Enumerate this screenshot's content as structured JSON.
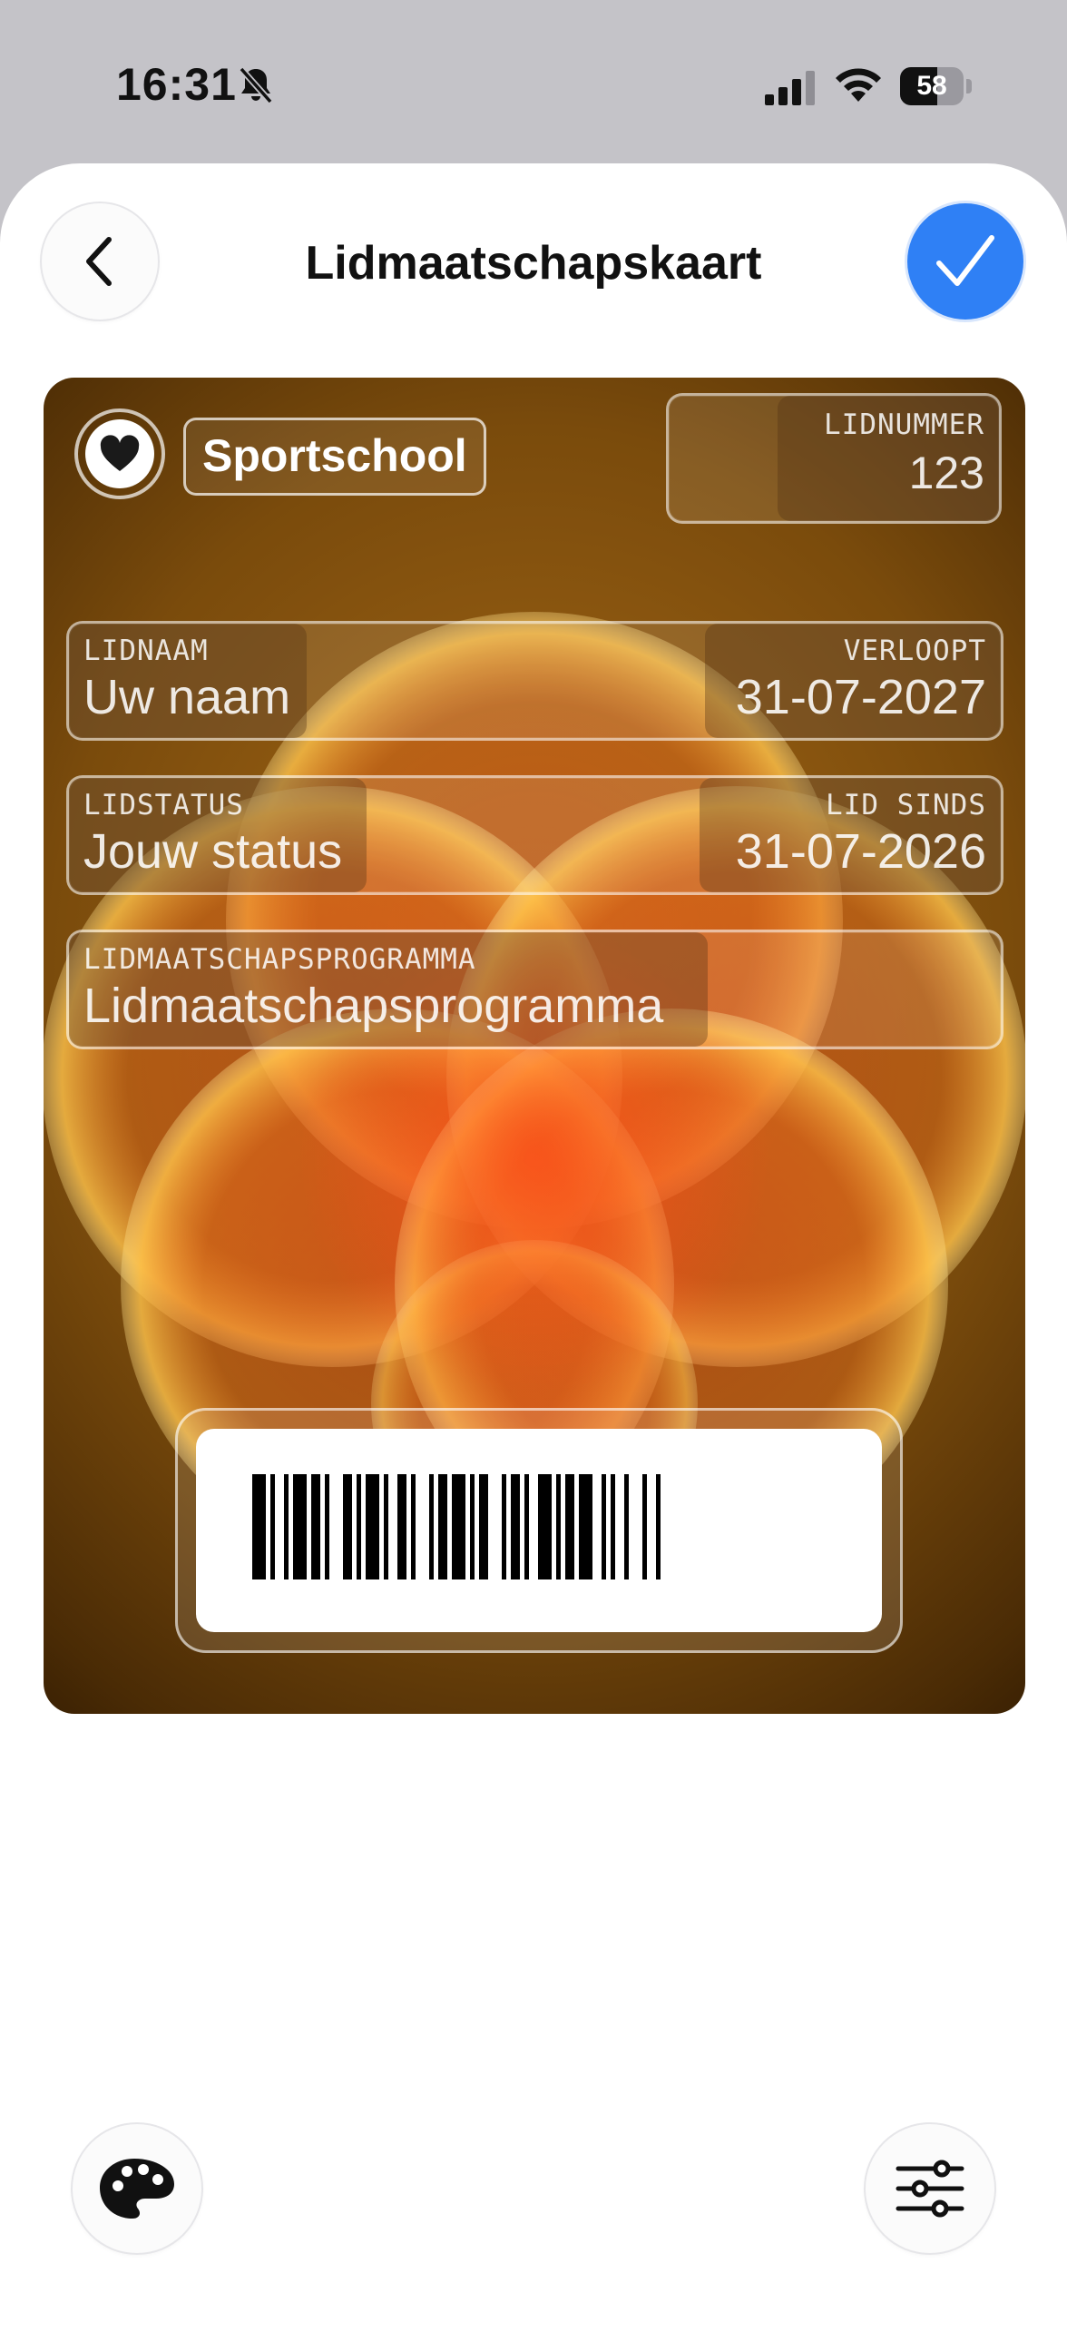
{
  "status_bar": {
    "time": "16:31",
    "battery": "58",
    "battery_level": 0.58
  },
  "header": {
    "title": "Lidmaatschapskaart"
  },
  "card": {
    "brand_name": "Sportschool",
    "member_number_label": "LIDNUMMER",
    "member_number_value": "123",
    "name_label": "LIDNAAM",
    "name_value": "Uw naam",
    "expires_label": "VERLOOPT",
    "expires_value": "31-07-2027",
    "status_label": "LIDSTATUS",
    "status_value": "Jouw status",
    "since_label": "LID SINDS",
    "since_value": "31-07-2026",
    "program_label": "LIDMAATSCHAPSPROGRAMMA",
    "program_value": "Lidmaatschapsprogramma"
  },
  "colors": {
    "accent": "#2f80f5",
    "card_base": "#7a4b0c"
  },
  "icons": {
    "back": "chevron-left-icon",
    "confirm": "checkmark-icon",
    "brand": "heart-icon",
    "palette": "palette-icon",
    "settings": "sliders-icon"
  }
}
